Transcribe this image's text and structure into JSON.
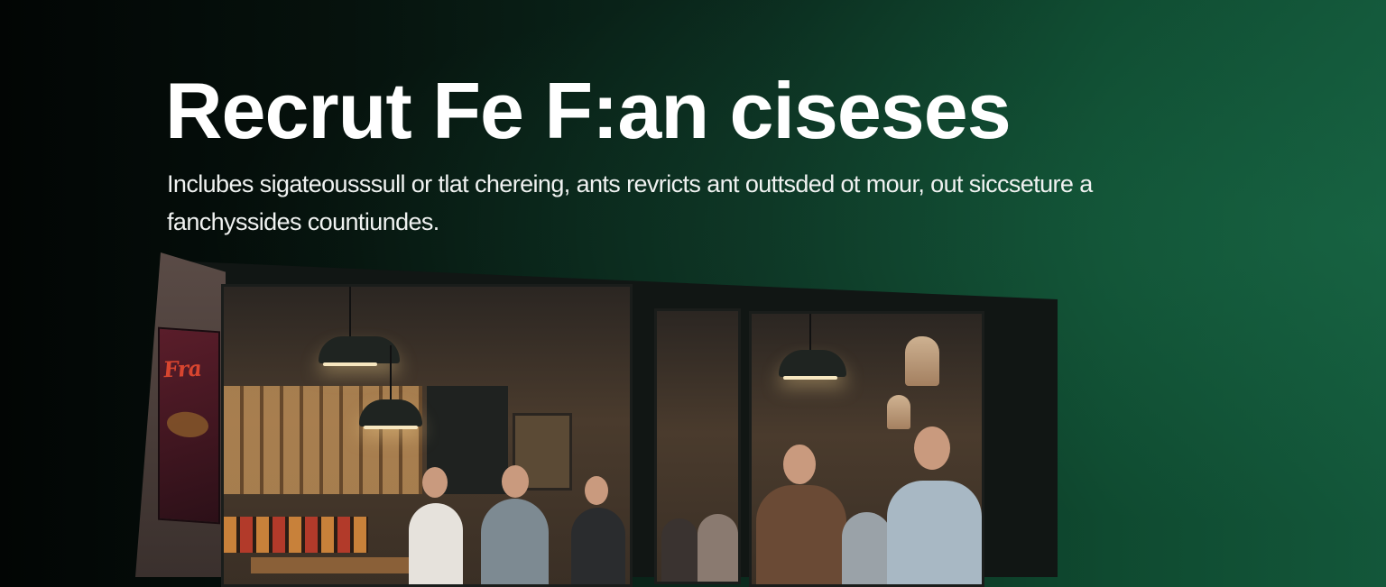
{
  "hero": {
    "title": "Recrut Fe  F:an ciseses",
    "subtitle": "Inclubes sigateousssull or tlat chereing, ants revricts ant outtsded  ot mour, out siccseture a fanchyssides countiundes.",
    "poster_lettering": "Fra"
  },
  "colors": {
    "background_dark": "#020504",
    "background_green": "#13573a",
    "text": "#ffffff"
  },
  "image": {
    "subject": "storefront-photo"
  }
}
